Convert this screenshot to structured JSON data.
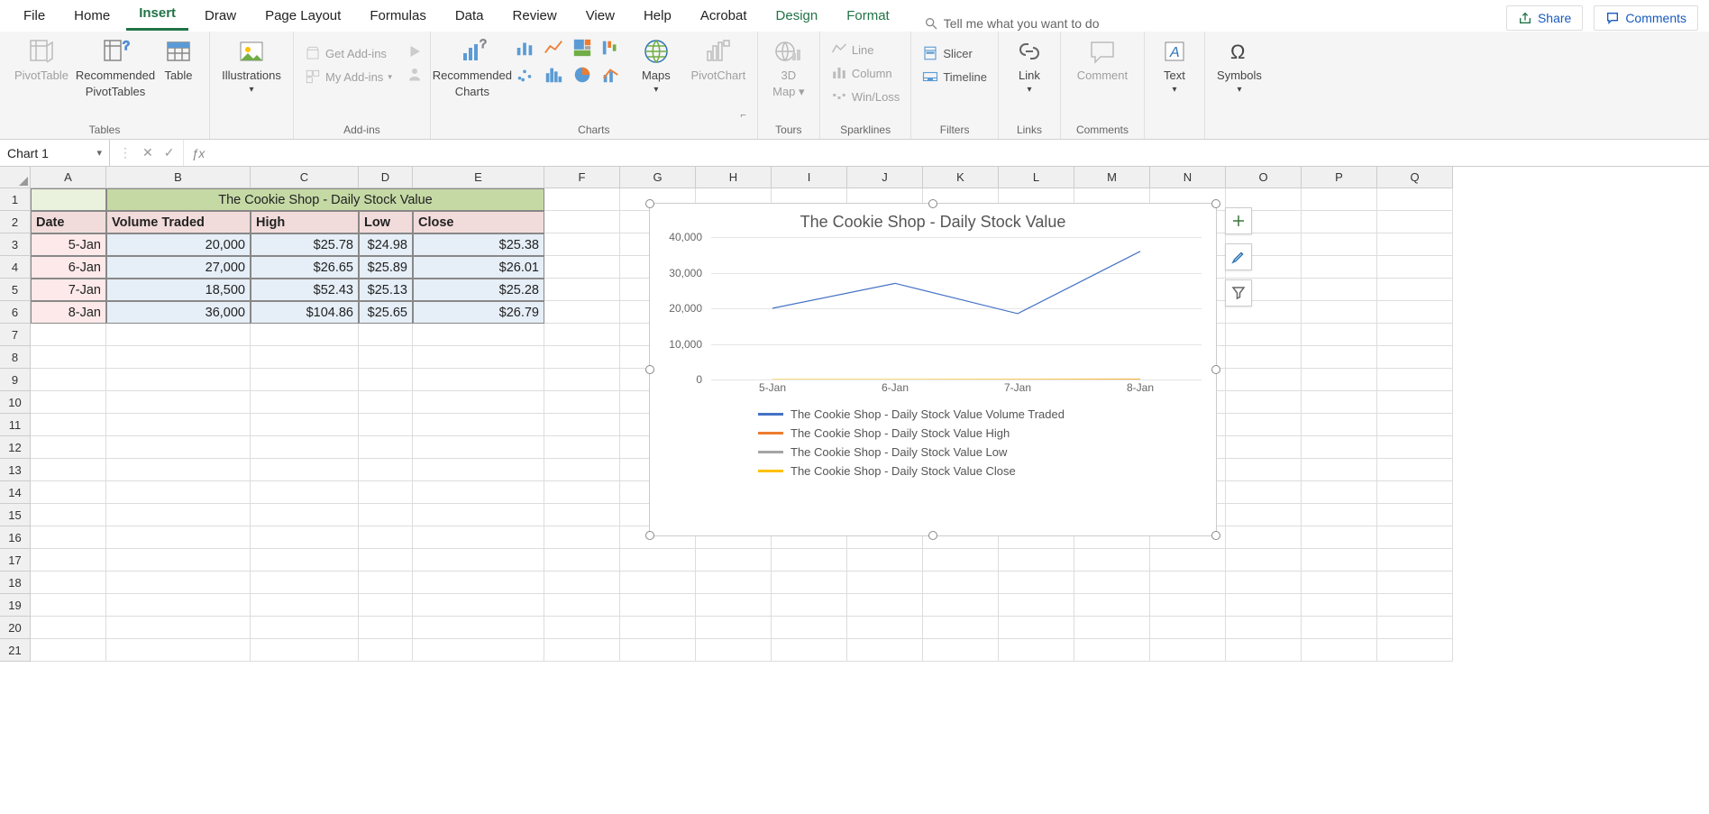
{
  "tabs": {
    "file": "File",
    "home": "Home",
    "insert": "Insert",
    "draw": "Draw",
    "pagelayout": "Page Layout",
    "formulas": "Formulas",
    "data": "Data",
    "review": "Review",
    "view": "View",
    "help": "Help",
    "acrobat": "Acrobat",
    "design": "Design",
    "format": "Format"
  },
  "tellme": "Tell me what you want to do",
  "share": "Share",
  "comments": "Comments",
  "ribbon": {
    "tables": {
      "label": "Tables",
      "pivot": "PivotTable",
      "recpivot_l1": "Recommended",
      "recpivot_l2": "PivotTables",
      "table": "Table"
    },
    "illus": {
      "label": "Illustrations",
      "btn": "Illustrations"
    },
    "addins": {
      "label": "Add-ins",
      "get": "Get Add-ins",
      "my": "My Add-ins"
    },
    "charts": {
      "label": "Charts",
      "rec_l1": "Recommended",
      "rec_l2": "Charts",
      "maps": "Maps",
      "pivotchart": "PivotChart"
    },
    "tours": {
      "label": "Tours",
      "map_l1": "3D",
      "map_l2": "Map"
    },
    "spark": {
      "label": "Sparklines",
      "line": "Line",
      "column": "Column",
      "winloss": "Win/Loss"
    },
    "filters": {
      "label": "Filters",
      "slicer": "Slicer",
      "timeline": "Timeline"
    },
    "links": {
      "label": "Links",
      "link": "Link"
    },
    "commentsg": {
      "label": "Comments",
      "comment": "Comment"
    },
    "text": {
      "label": "Text",
      "btn": "Text"
    },
    "symbols": {
      "label": "Symbols",
      "btn": "Symbols"
    }
  },
  "namebox": "Chart 1",
  "colw": {
    "A": 84,
    "B": 160,
    "C": 120,
    "D": 60,
    "E": 146,
    "rest": 84
  },
  "cols": [
    "A",
    "B",
    "C",
    "D",
    "E",
    "F",
    "G",
    "H",
    "I",
    "J",
    "K",
    "L",
    "M",
    "N",
    "O",
    "P",
    "Q"
  ],
  "rows": 21,
  "table": {
    "title": "The Cookie Shop - Daily Stock Value",
    "headers": {
      "date": "Date",
      "vol": "Volume Traded",
      "high": "High",
      "low": "Low",
      "close": "Close"
    },
    "data": [
      {
        "date": "5-Jan",
        "vol": "20,000",
        "high": "$25.78",
        "low": "$24.98",
        "close": "$25.38"
      },
      {
        "date": "6-Jan",
        "vol": "27,000",
        "high": "$26.65",
        "low": "$25.89",
        "close": "$26.01"
      },
      {
        "date": "7-Jan",
        "vol": "18,500",
        "high": "$52.43",
        "low": "$25.13",
        "close": "$25.28"
      },
      {
        "date": "8-Jan",
        "vol": "36,000",
        "high": "$104.86",
        "low": "$25.65",
        "close": "$26.79"
      }
    ]
  },
  "chart": {
    "title": "The Cookie Shop - Daily Stock Value",
    "yticks": [
      "40,000",
      "30,000",
      "20,000",
      "10,000",
      "0"
    ],
    "xcats": [
      "5-Jan",
      "6-Jan",
      "7-Jan",
      "8-Jan"
    ],
    "legend": [
      {
        "color": "#4472c4",
        "label": "The Cookie Shop - Daily Stock Value Volume Traded"
      },
      {
        "color": "#ed7d31",
        "label": "The Cookie Shop - Daily Stock Value High"
      },
      {
        "color": "#a5a5a5",
        "label": "The Cookie Shop - Daily Stock Value Low"
      },
      {
        "color": "#ffc000",
        "label": "The Cookie Shop - Daily Stock Value Close"
      }
    ]
  },
  "chart_data": {
    "type": "line",
    "title": "The Cookie Shop - Daily Stock Value",
    "xlabel": "",
    "ylabel": "",
    "ylim": [
      0,
      40000
    ],
    "categories": [
      "5-Jan",
      "6-Jan",
      "7-Jan",
      "8-Jan"
    ],
    "series": [
      {
        "name": "The Cookie Shop - Daily Stock Value Volume Traded",
        "values": [
          20000,
          27000,
          18500,
          36000
        ]
      },
      {
        "name": "The Cookie Shop - Daily Stock Value High",
        "values": [
          25.78,
          26.65,
          52.43,
          104.86
        ]
      },
      {
        "name": "The Cookie Shop - Daily Stock Value Low",
        "values": [
          24.98,
          25.89,
          25.13,
          25.65
        ]
      },
      {
        "name": "The Cookie Shop - Daily Stock Value Close",
        "values": [
          25.38,
          26.01,
          25.28,
          26.79
        ]
      }
    ]
  }
}
